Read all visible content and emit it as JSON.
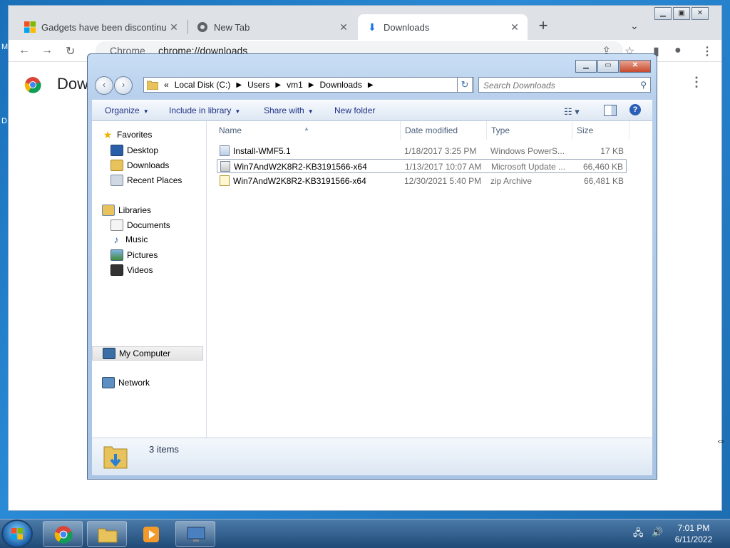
{
  "chrome": {
    "tabs": [
      {
        "title": "Gadgets have been discontinued",
        "icon": "microsoft-logo-icon"
      },
      {
        "title": "New Tab",
        "icon": "chrome-logo-icon"
      },
      {
        "title": "Downloads",
        "icon": "download-arrow-icon"
      }
    ],
    "active_tab": 2,
    "omnibox_site": "Chrome",
    "omnibox_url": "chrome://downloads",
    "page_heading": "Downloads"
  },
  "explorer": {
    "address": [
      "Local Disk (C:)",
      "Users",
      "vm1",
      "Downloads"
    ],
    "address_prefix": "«",
    "search_placeholder": "Search Downloads",
    "commands": [
      "Organize",
      "Include in library",
      "Share with",
      "New folder"
    ],
    "nav": {
      "favorites_header": "Favorites",
      "favorites": [
        "Desktop",
        "Downloads",
        "Recent Places"
      ],
      "libraries_header": "Libraries",
      "libraries": [
        "Documents",
        "Music",
        "Pictures",
        "Videos"
      ],
      "computer": "My Computer",
      "network": "Network"
    },
    "columns": {
      "name": "Name",
      "date": "Date modified",
      "type": "Type",
      "size": "Size"
    },
    "files": [
      {
        "name": "Install-WMF5.1",
        "date": "1/18/2017 3:25 PM",
        "type": "Windows PowerS...",
        "size": "17 KB",
        "icon": "powershell-script-icon"
      },
      {
        "name": "Win7AndW2K8R2-KB3191566-x64",
        "date": "1/13/2017 10:07 AM",
        "type": "Microsoft Update ...",
        "size": "66,460 KB",
        "icon": "update-package-icon"
      },
      {
        "name": "Win7AndW2K8R2-KB3191566-x64",
        "date": "12/30/2021 5:40 PM",
        "type": "zip Archive",
        "size": "66,481 KB",
        "icon": "zip-archive-icon"
      }
    ],
    "status_count": "3 items"
  },
  "taskbar": {
    "time": "7:01 PM",
    "date": "6/11/2022",
    "pinned": [
      "chrome-icon",
      "explorer-folder-icon",
      "media-player-icon",
      "remote-desktop-icon"
    ]
  },
  "colors": {
    "desktop": "#1a6fb8",
    "explorer_frame": "#b8d0ec",
    "chrome_strip": "#dee1e6"
  }
}
